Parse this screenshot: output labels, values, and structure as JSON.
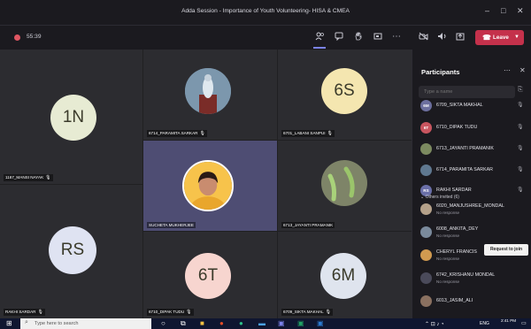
{
  "window": {
    "title": "Adda Session - Importance of Youth Volunteering- HISA & CMEA",
    "minimize": "–",
    "restore": "□",
    "close": "✕"
  },
  "callbar": {
    "timer": "55:39",
    "leave_label": "Leave",
    "icons": [
      "participants-icon",
      "chat-icon",
      "raise-hand-icon",
      "rooms-icon",
      "more-icon",
      "camera-off-icon",
      "mic-icon",
      "share-icon"
    ]
  },
  "tiles": [
    {
      "initials": "1N",
      "name": "1167_MANSI NAYAK",
      "color": "#e7ebd3",
      "photo": false
    },
    {
      "initials": "",
      "name": "6714_PARAMITA SARKAR",
      "color": "#6f8da8",
      "photo": true
    },
    {
      "initials": "6S",
      "name": "6701_LABANI SANPUI",
      "color": "#f4e6b0",
      "photo": false
    },
    {
      "initials": "",
      "name": "SUCHETA MUKHERJEE",
      "color": "#f7c34b",
      "photo": true
    },
    {
      "initials": "",
      "name": "6713_JAYANTI PRAMANIK",
      "color": "#8a8f6a",
      "photo": true
    },
    {
      "initials": "RS",
      "name": "RAKHI SARDAR",
      "color": "#dfe3f2",
      "photo": false
    },
    {
      "initials": "6T",
      "name": "6710_DIPAK TUDU",
      "color": "#f7d5cf",
      "photo": false
    },
    {
      "initials": "6M",
      "name": "6709_SIKTA MAKHAL",
      "color": "#dfe4ee",
      "photo": false
    }
  ],
  "participants": {
    "title": "Participants",
    "search_placeholder": "Type a name",
    "section_label": "Others invited (6)",
    "tooltip": "Request to join",
    "people": [
      {
        "initials": "6M",
        "name": "6709_SIKTA MAKHAL",
        "sub": "",
        "color": "#6c6f9e"
      },
      {
        "initials": "6T",
        "name": "6710_DIPAK TUDU",
        "sub": "",
        "color": "#c8555f"
      },
      {
        "initials": "",
        "name": "6713_JAYANTI PRAMANIK",
        "sub": "",
        "color": "#7c8a60"
      },
      {
        "initials": "",
        "name": "6714_PARAMITA SARKAR",
        "sub": "",
        "color": "#5f7890"
      },
      {
        "initials": "RS",
        "name": "RAKHI SARDAR",
        "sub": "",
        "color": "#6a6fa8"
      }
    ],
    "invited": [
      {
        "initials": "",
        "name": "6020_MANJUSHREE_MONDAL",
        "sub": "No response",
        "color": "#b5a18a"
      },
      {
        "initials": "",
        "name": "6008_ANKITA_DEY",
        "sub": "No response",
        "color": "#7a8a9c"
      },
      {
        "initials": "",
        "name": "CHERYL FRANCIS",
        "sub": "No response",
        "color": "#d19a50"
      },
      {
        "initials": "",
        "name": "6742_KRISHANU MONDAL",
        "sub": "No response",
        "color": "#4a4a5a"
      },
      {
        "initials": "",
        "name": "6013_JASIM_ALI",
        "sub": "",
        "color": "#8a7060"
      }
    ]
  },
  "taskbar": {
    "search_placeholder": "Type here to search",
    "time": "2:41 PM",
    "lang": "ENG"
  }
}
